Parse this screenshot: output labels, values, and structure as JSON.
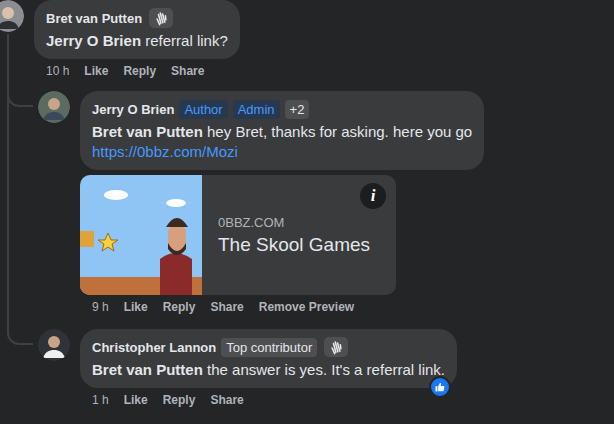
{
  "comment": {
    "author": "Bret van Putten",
    "fan_badge": true,
    "mention": "Jerry O Brien",
    "text": " referral link?",
    "time": "10 h",
    "actions": [
      "Like",
      "Reply",
      "Share"
    ]
  },
  "replies": [
    {
      "author": "Jerry O Brien",
      "fan_badge": false,
      "badges": [
        {
          "label": "Author",
          "kind": "role"
        },
        {
          "label": "Admin",
          "kind": "role"
        },
        {
          "label": "+2",
          "kind": "more"
        }
      ],
      "mention": "Bret van Putten",
      "text": " hey Bret, thanks for asking. here you go",
      "link": "https://0bbz.com/Mozi",
      "preview": {
        "domain": "0BBZ.COM",
        "title": "The Skool Games",
        "info": "i"
      },
      "time": "9 h",
      "actions": [
        "Like",
        "Reply",
        "Share",
        "Remove Preview"
      ],
      "reacted": false
    },
    {
      "author": "Christopher Lannon",
      "fan_badge": true,
      "badges": [
        {
          "label": "Top contributor",
          "kind": "contributor"
        }
      ],
      "mention": "Bret van Putten",
      "text": " the answer is yes. It's a referral link.",
      "time": "1 h",
      "actions": [
        "Like",
        "Reply",
        "Share"
      ],
      "reacted": true
    }
  ]
}
